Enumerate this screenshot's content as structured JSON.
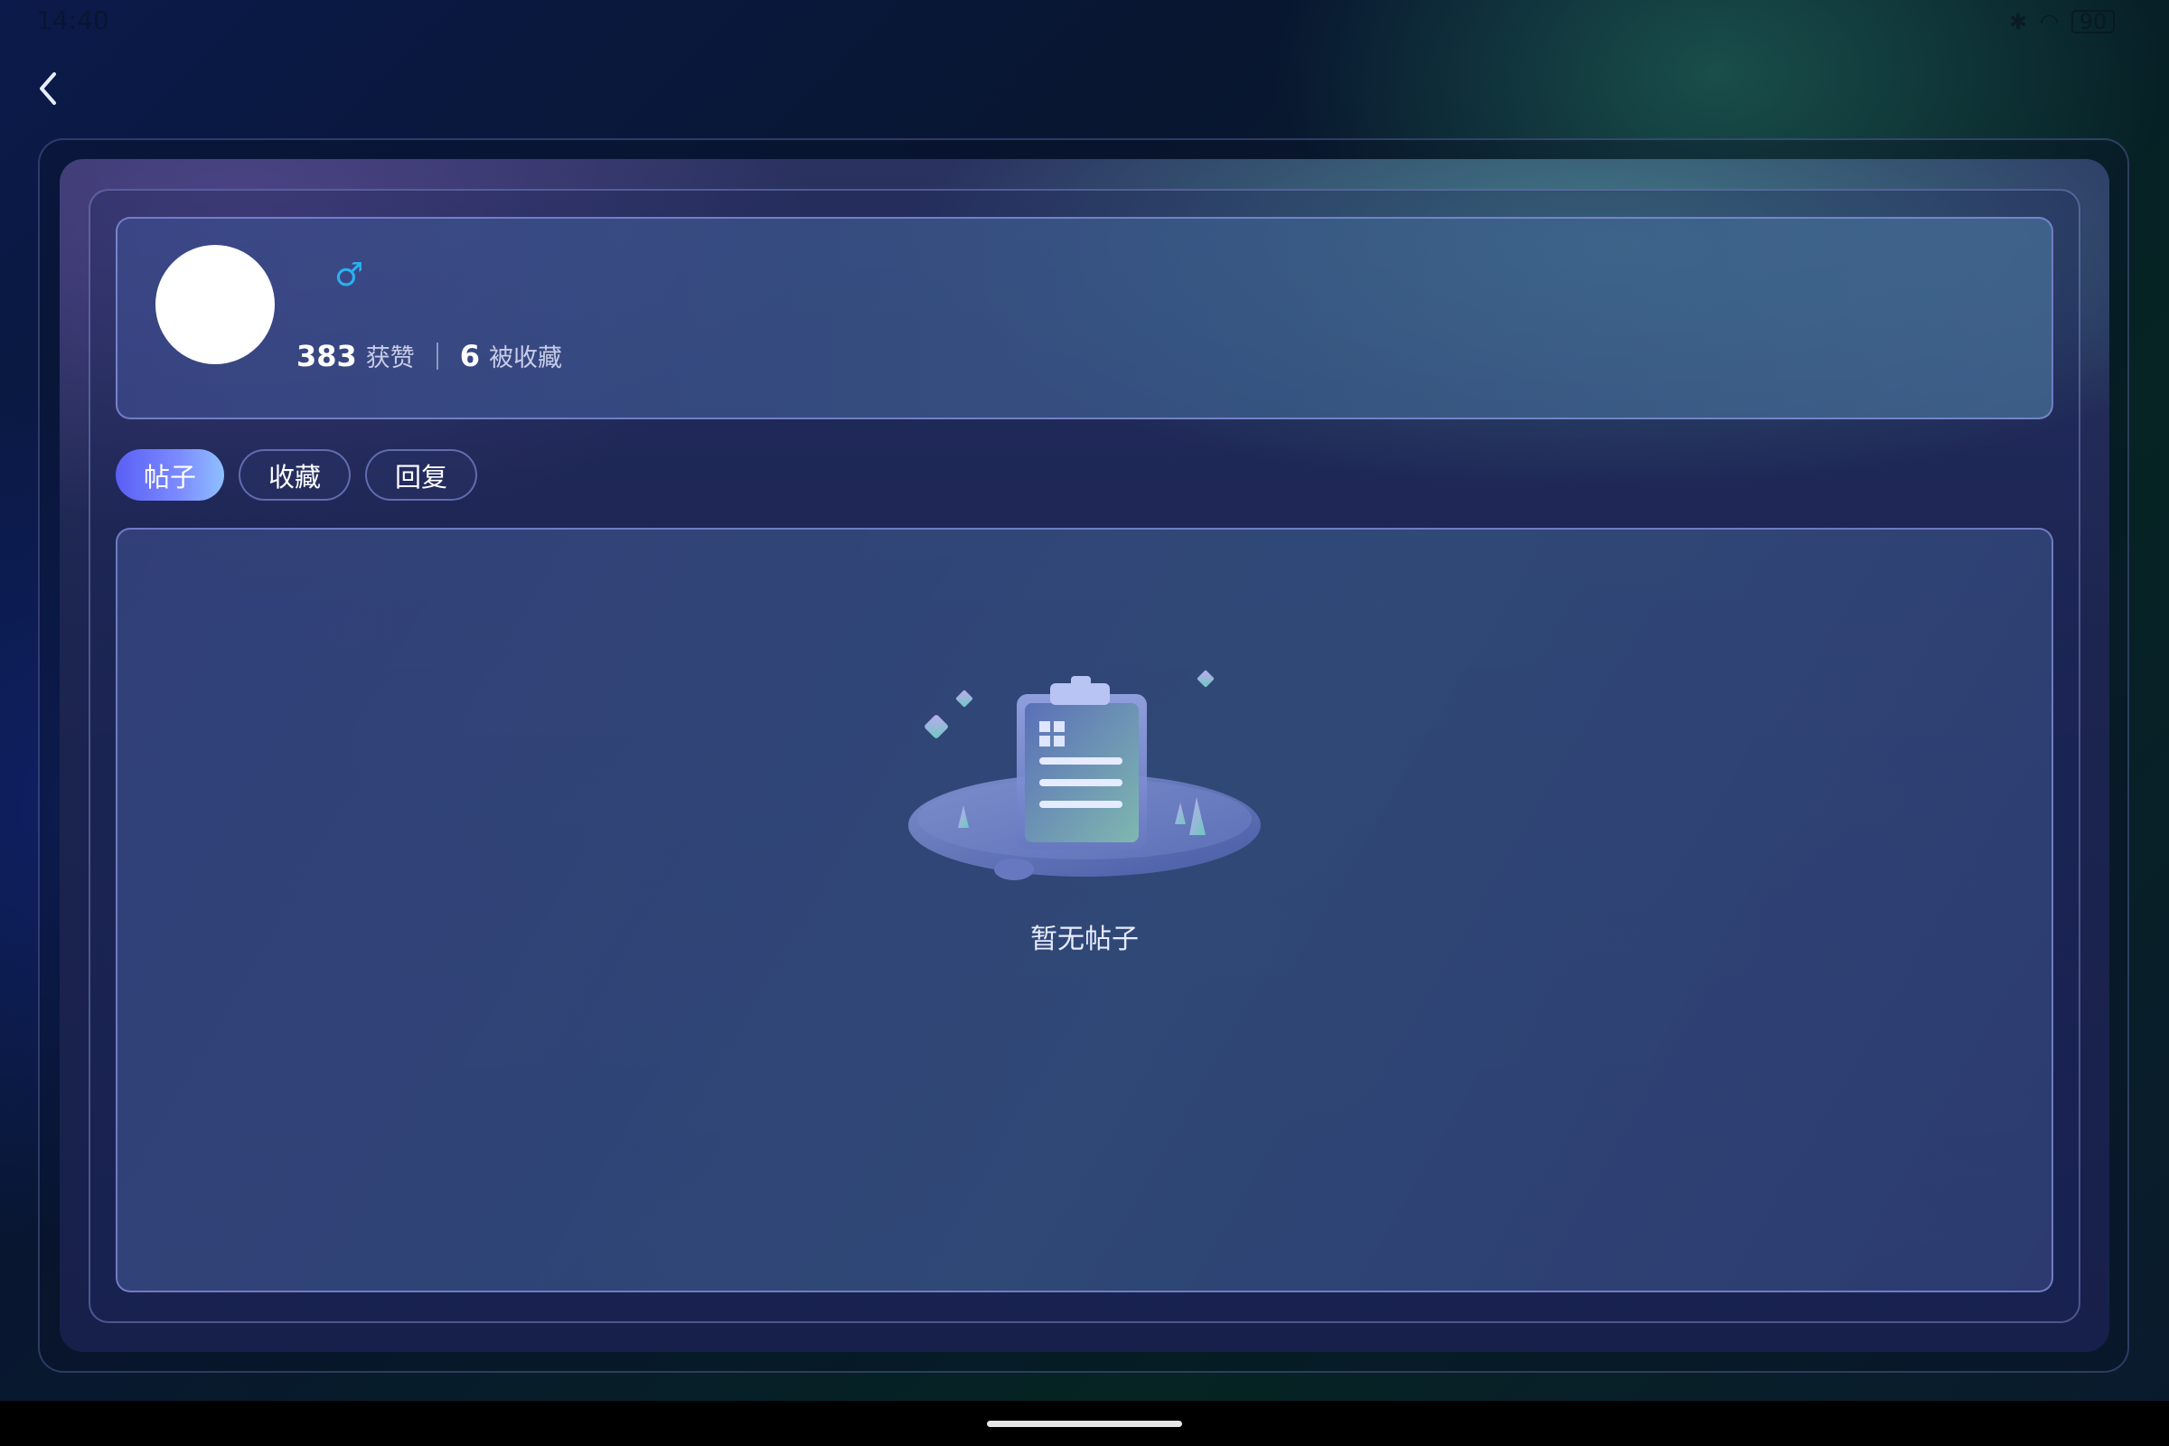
{
  "status_bar": {
    "time": "14:40",
    "battery": "90"
  },
  "profile": {
    "gender_symbol": "♂",
    "likes_count": "383",
    "likes_label": "获赞",
    "favorites_count": "6",
    "favorites_label": "被收藏"
  },
  "tabs": [
    {
      "label": "帖子",
      "active": true
    },
    {
      "label": "收藏",
      "active": false
    },
    {
      "label": "回复",
      "active": false
    }
  ],
  "empty_state": {
    "text": "暂无帖子"
  },
  "colors": {
    "accent": "#5a5ff5",
    "gender": "#2ab0f0"
  }
}
